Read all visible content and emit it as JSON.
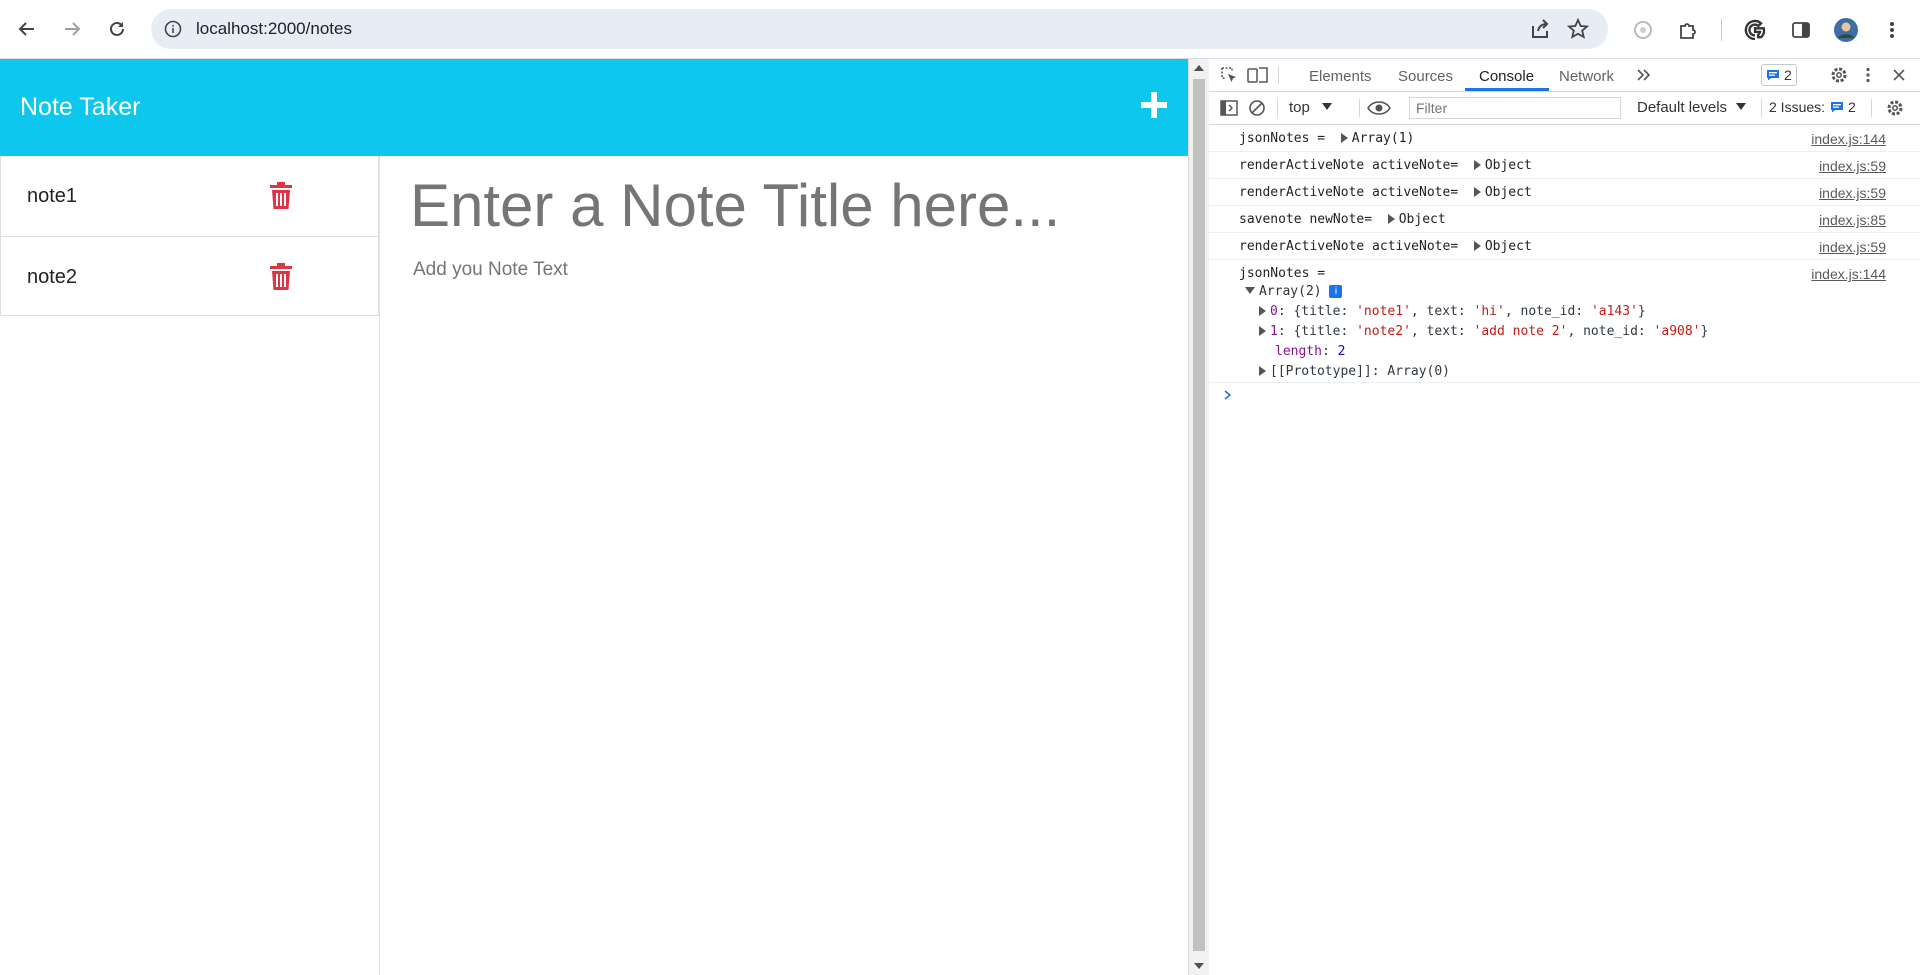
{
  "browser": {
    "url": "localhost:2000/notes",
    "icons": [
      "back-icon",
      "forward-icon",
      "reload-icon",
      "site-info-icon",
      "share-icon",
      "star-icon",
      "extension-icon",
      "puzzle-icon",
      "google-icon",
      "side-panel-icon",
      "avatar",
      "menu-icon"
    ]
  },
  "app": {
    "title": "Note Taker",
    "notes": [
      {
        "title": "note1"
      },
      {
        "title": "note2"
      }
    ],
    "title_placeholder": "Enter a Note Title here...",
    "text_placeholder": "Add you Note Text",
    "colors": {
      "header": "#0dc7ef",
      "trash": "#dc3545"
    }
  },
  "devtools": {
    "tabs": [
      "Elements",
      "Sources",
      "Console",
      "Network"
    ],
    "active_tab": "Console",
    "messages_badge": "2",
    "context": "top",
    "filter_placeholder": "Filter",
    "levels": "Default levels",
    "issues_label": "2 Issues:",
    "issues_count": "2",
    "logs": [
      {
        "text": "jsonNotes = ",
        "value": "Array(1)",
        "source": "index.js:144"
      },
      {
        "text": "renderActiveNote activeNote= ",
        "value": "Object",
        "source": "index.js:59"
      },
      {
        "text": "renderActiveNote activeNote= ",
        "value": "Object",
        "source": "index.js:59"
      },
      {
        "text": "savenote newNote= ",
        "value": "Object",
        "source": "index.js:85"
      },
      {
        "text": "renderActiveNote activeNote= ",
        "value": "Object",
        "source": "index.js:59"
      }
    ],
    "expanded_log": {
      "text": "jsonNotes =",
      "source": "index.js:144",
      "array_label": "Array(2)",
      "info": "i",
      "items": [
        {
          "index": "0",
          "title": "'note1'",
          "text": "'hi'",
          "note_id": "'a143'"
        },
        {
          "index": "1",
          "title": "'note2'",
          "text": "'add note 2'",
          "note_id": "'a908'"
        }
      ],
      "length_key": "length",
      "length_value": "2",
      "prototype": "[[Prototype]]: Array(0)"
    }
  }
}
